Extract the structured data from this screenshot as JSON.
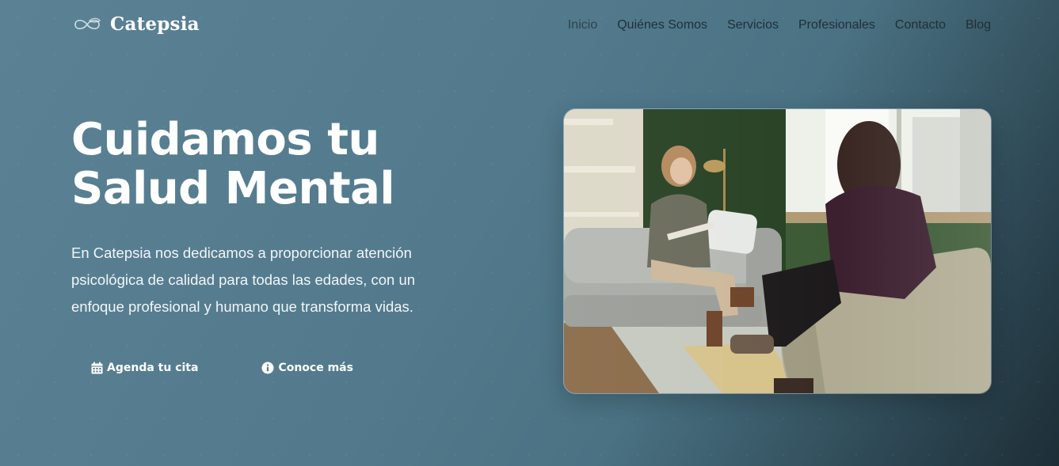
{
  "brand": {
    "name": "Catepsia",
    "logo_icon": "infinity-leaf-logo"
  },
  "nav": {
    "items": [
      {
        "label": "Inicio",
        "active": true
      },
      {
        "label": "Quiénes Somos"
      },
      {
        "label": "Servicios"
      },
      {
        "label": "Profesionales"
      },
      {
        "label": "Contacto"
      },
      {
        "label": "Blog"
      }
    ]
  },
  "hero": {
    "title": "Cuidamos tu Salud Mental",
    "description": "En Catepsia nos dedicamos a proporcionar atención psicológica de calidad para todas las edades, con un enfoque profesional y humano que transforma vidas.",
    "primary_cta": {
      "label": "Agenda tu cita",
      "icon": "calendar-icon"
    },
    "secondary_cta": {
      "label": "Conoce más",
      "icon": "info-circle-icon"
    },
    "image": {
      "subject": "therapy-session-photo"
    }
  },
  "colors": {
    "background": "#527a8c",
    "background_dark": "#1d2e36",
    "nav_text": "#1f2f37",
    "text": "#ffffff"
  }
}
